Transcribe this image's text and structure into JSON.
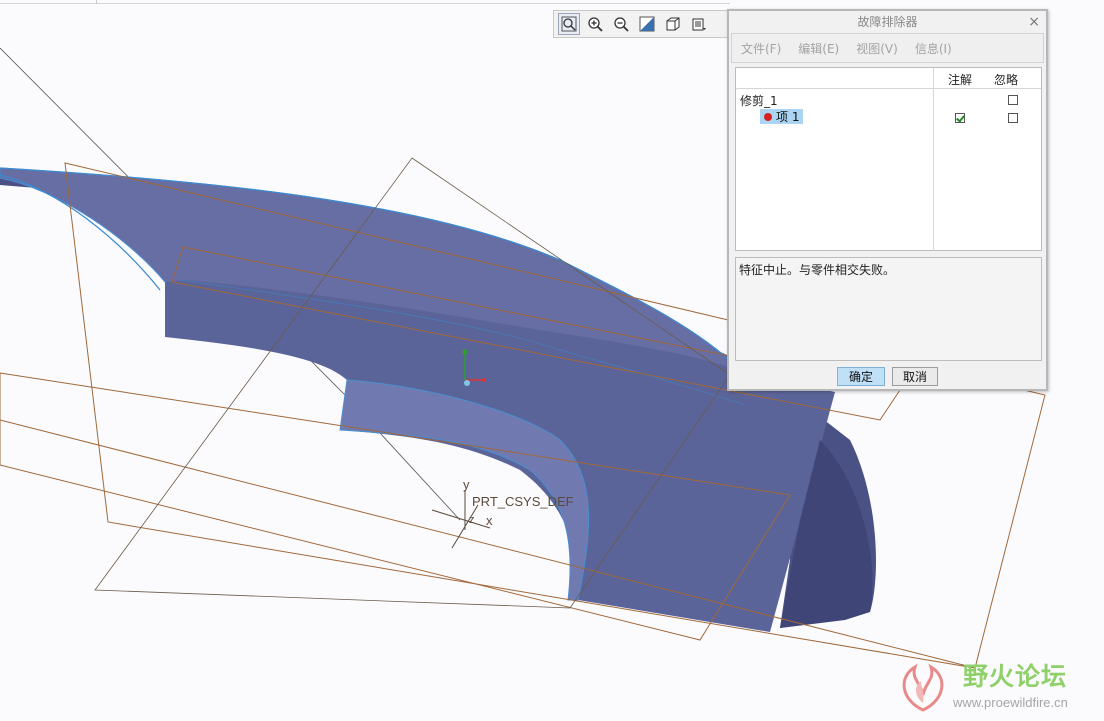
{
  "dialog": {
    "title": "故障排除器",
    "close_glyph": "×",
    "menu": [
      "文件(F)",
      "编辑(E)",
      "视图(V)",
      "信息(I)"
    ],
    "columns": {
      "notes": "注解",
      "ignore": "忽略"
    },
    "tree": [
      {
        "label": "修剪_1",
        "notes_checked": null,
        "ignore_checked": false
      },
      {
        "label": "项 1",
        "status": "error",
        "notes_checked": true,
        "ignore_checked": false,
        "selected": true
      }
    ],
    "message": "特征中止。与零件相交失败。",
    "ok_label": "确定",
    "cancel_label": "取消"
  },
  "toolbar": {
    "icons": [
      "zoom-fit-icon",
      "zoom-in-icon",
      "zoom-out-icon",
      "repaint-icon",
      "display-style-icon",
      "saved-views-icon"
    ]
  },
  "viewport": {
    "csys_name": "PRT_CSYS_DEF",
    "axis_y": "y",
    "axis_z": "z",
    "axis_x": "x",
    "surface_color": "#6a73a8",
    "datum_plane_color": "#a0683a"
  },
  "watermark": {
    "title": "野火论坛",
    "url": "www.proewildfire.cn"
  }
}
